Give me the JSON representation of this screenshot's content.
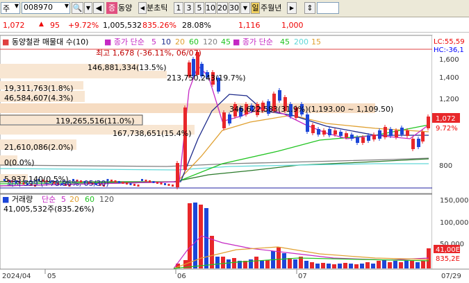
{
  "toolbar": {
    "market": "주",
    "code": "008970",
    "name": "동양",
    "name_badge": "증",
    "period_label": "분초틱",
    "minutes": [
      "1",
      "3",
      "5",
      "10",
      "20",
      "30"
    ],
    "minute_selected": "30",
    "day": "일",
    "rest": "주월년"
  },
  "quote": {
    "price": "1,072",
    "change": "95",
    "change_pct": "+9.72%",
    "volume": "1,005,532",
    "volume_ratio": "835.26%",
    "turnover": "28.08%",
    "v1": "1,116",
    "v2": "1,000"
  },
  "price_legend": {
    "title": "동양철관 매물대 수(10)",
    "ma_label": "종가 단순",
    "ma": [
      "5",
      "10",
      "20",
      "60",
      "120",
      "45"
    ],
    "ma2_label": "종가 단순",
    "ma2": [
      "45",
      "200",
      "15"
    ]
  },
  "annotations": {
    "high": "최고 1,678 (-36.11%, 06/07)",
    "low": "최저 599 (+78.96%, 05/30)",
    "lc": "LC:55,59",
    "hc": "HC:-36,1",
    "current": "1,072",
    "current_pct": "9.72%"
  },
  "profile_labels": [
    "146,881,334(13.5%)",
    "213,750,243(19.7%)",
    "19,311,763(1.8%)",
    "46,584,607(4.3%)",
    "346,622,583(31.9%)(1,193.00 ~ 1,109.50)",
    "119,265,516(11.0%)",
    "167,738,651(15.4%)",
    "21,610,086(2.0%)",
    "0(0.0%)",
    "5,937,140(0.5%)"
  ],
  "price_axis": [
    "1,600",
    "1,400",
    "1,200",
    "800"
  ],
  "volume_legend": {
    "title": "거래량",
    "ma_label": "단순",
    "ma": [
      "5",
      "20",
      "60",
      "120"
    ],
    "value": "41,005,532주(835.26%)"
  },
  "volume_axis": [
    "150,000",
    "100,000",
    "50,000"
  ],
  "volume_current": "41,00E",
  "volume_current_pct": "835,2E",
  "x_labels": [
    "2024/04",
    "05",
    "06",
    "07",
    "07/29"
  ],
  "colors": {
    "up": "#e8272a",
    "down": "#1c46d8",
    "ma5": "#c428c4",
    "ma10": "#1d2a8a",
    "ma20": "#e0a030",
    "ma60": "#22c422",
    "ma120": "#2a7a2a",
    "ma200": "#60d8d8",
    "ma45": "#808080"
  }
}
